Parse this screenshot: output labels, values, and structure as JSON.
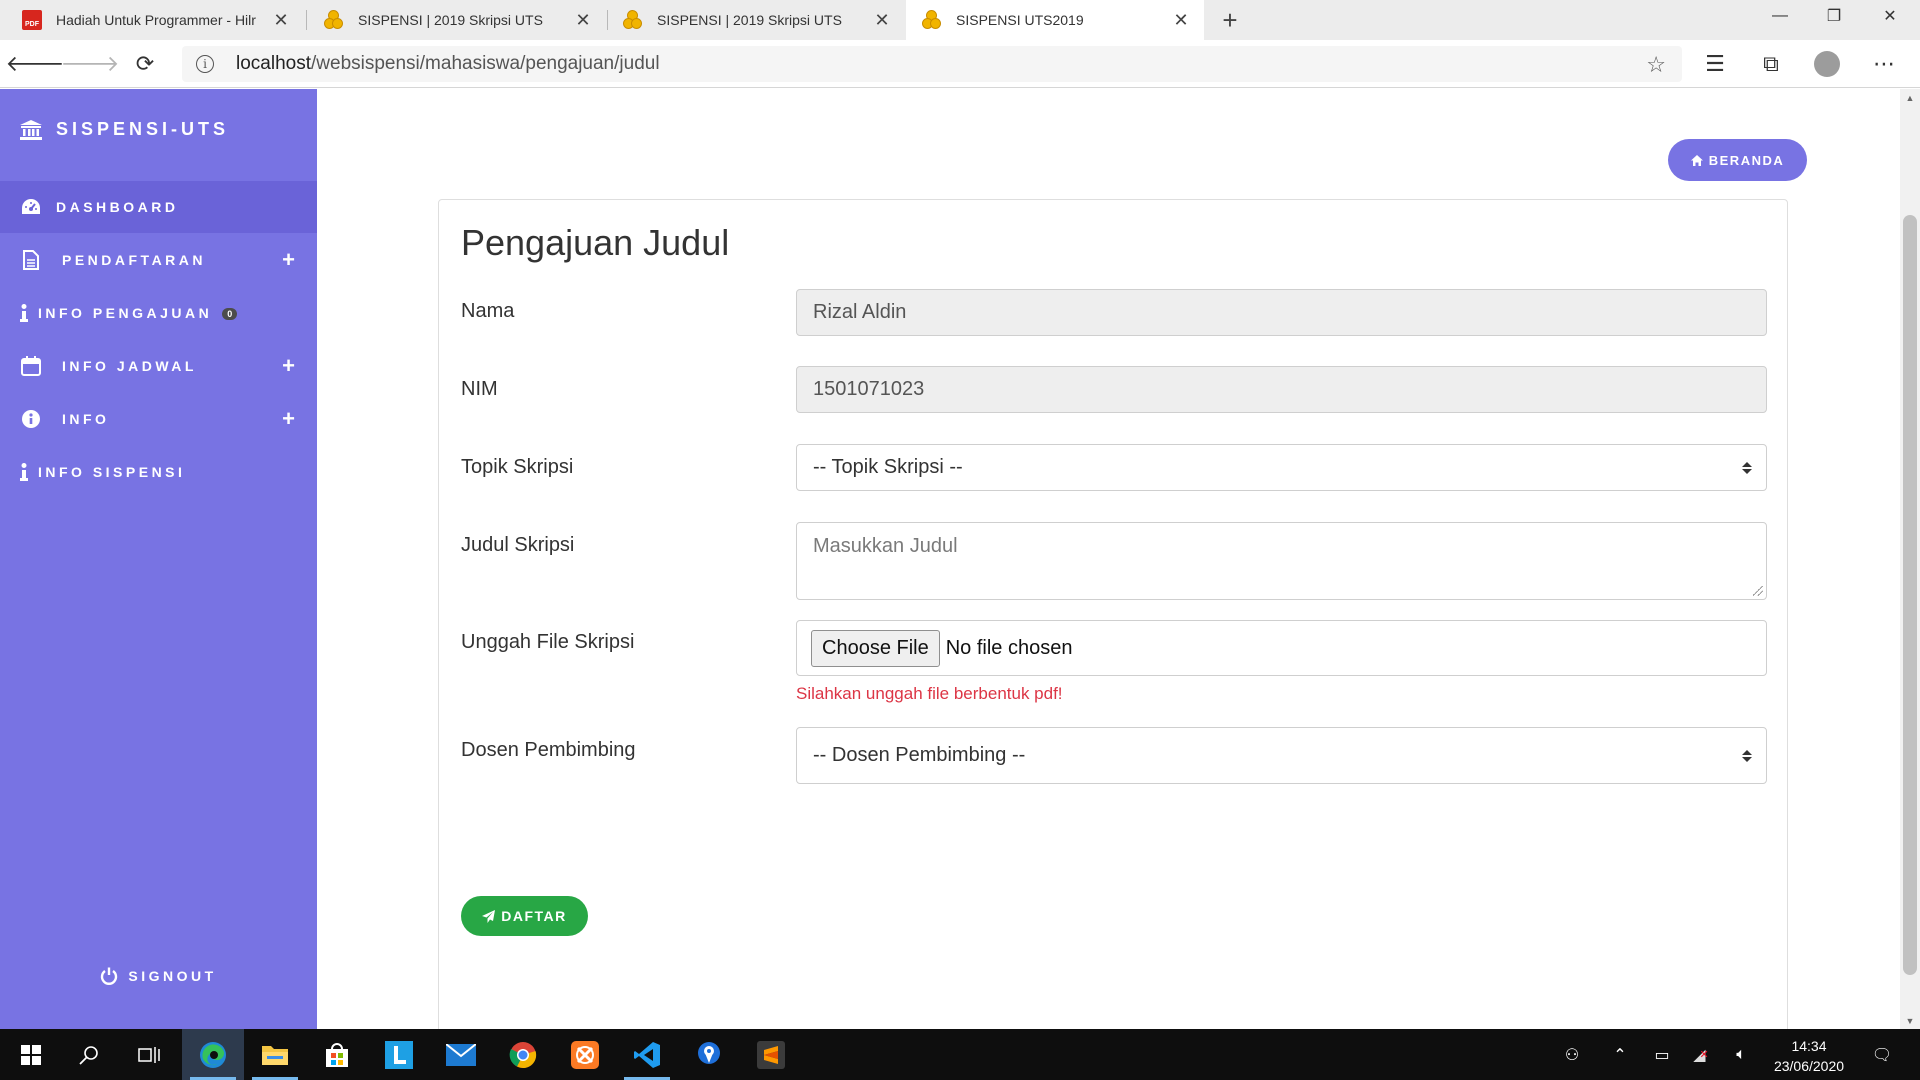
{
  "browser": {
    "tabs": [
      {
        "title": "Hadiah Untuk Programmer - Hilr",
        "icon": "pdf-icon",
        "active": false
      },
      {
        "title": "SISPENSI | 2019 Skripsi UTS",
        "icon": "sispensi-favicon",
        "active": false
      },
      {
        "title": "SISPENSI | 2019 Skripsi UTS",
        "icon": "sispensi-favicon",
        "active": false
      },
      {
        "title": "SISPENSI UTS2019",
        "icon": "sispensi-favicon",
        "active": true
      }
    ],
    "url_host": "localhost",
    "url_path": "/websispensi/mahasiswa/pengajuan/judul"
  },
  "sidebar": {
    "brand": "SISPENSI-UTS",
    "items": [
      {
        "label": "DASHBOARD",
        "icon": "dashboard-icon",
        "active": true,
        "expand": ""
      },
      {
        "label": "PENDAFTARAN",
        "icon": "document-icon",
        "active": false,
        "expand": "+"
      },
      {
        "label": "INFO PENGAJUAN",
        "icon": "info-i-icon",
        "active": false,
        "expand": "",
        "badge": "0"
      },
      {
        "label": "INFO JADWAL",
        "icon": "calendar-icon",
        "active": false,
        "expand": "+"
      },
      {
        "label": "INFO",
        "icon": "info-circle-icon",
        "active": false,
        "expand": "+"
      },
      {
        "label": "INFO SISPENSI",
        "icon": "info-i-icon",
        "active": false,
        "expand": ""
      }
    ],
    "signout": "SIGNOUT"
  },
  "main": {
    "beranda_button": "BERANDA",
    "title": "Pengajuan Judul",
    "form": {
      "nama_label": "Nama",
      "nama_value": "Rizal Aldin",
      "nim_label": "NIM",
      "nim_value": "1501071023",
      "topik_label": "Topik Skripsi",
      "topik_selected": "-- Topik Skripsi --",
      "judul_label": "Judul Skripsi",
      "judul_placeholder": "Masukkan Judul",
      "unggah_label": "Unggah File Skripsi",
      "choose_file": "Choose File",
      "no_file": "No file chosen",
      "unggah_help": "Silahkan unggah file berbentuk pdf!",
      "dosen_label": "Dosen Pembimbing",
      "dosen_selected": "-- Dosen Pembimbing --",
      "submit": "DAFTAR"
    }
  },
  "taskbar": {
    "apps": [
      "windows-start-icon",
      "search-icon",
      "task-view-icon",
      "edge-icon",
      "file-explorer-icon",
      "store-icon",
      "l-app-icon",
      "mail-icon",
      "chrome-icon",
      "xampp-icon",
      "vscode-icon",
      "maps-icon",
      "sublime-text-icon"
    ],
    "time": "14:34",
    "date": "23/06/2020"
  },
  "colors": {
    "sidebar": "#7873e3",
    "sidebar_active": "#6a63d8",
    "success": "#28a745",
    "danger": "#dc3545"
  }
}
